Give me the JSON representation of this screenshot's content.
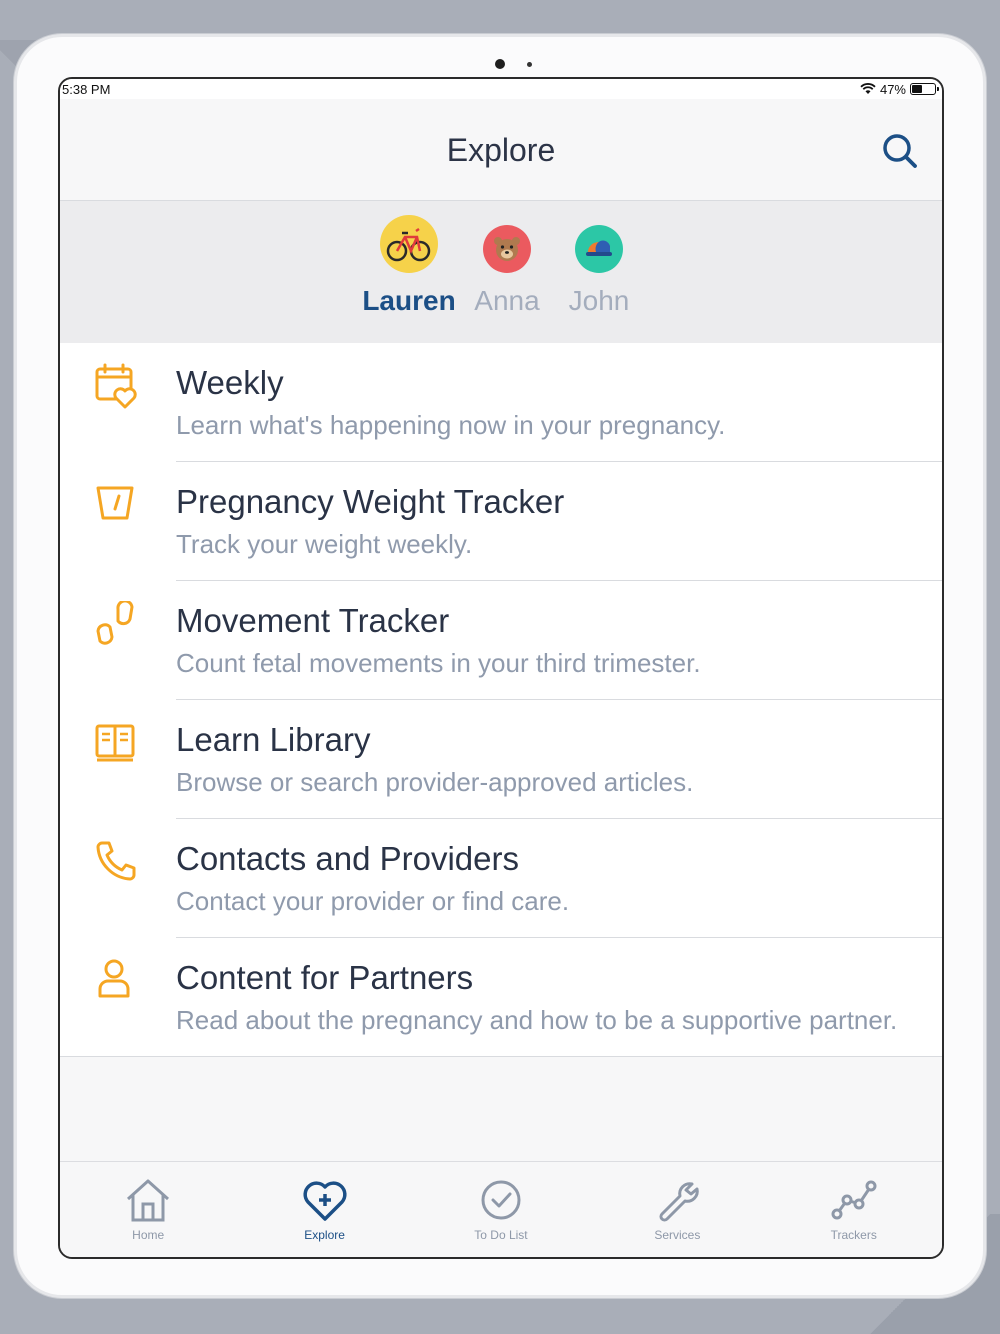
{
  "status": {
    "time": "5:38 PM",
    "battery": "47%",
    "battery_level": 0.47
  },
  "header": {
    "title": "Explore",
    "search_icon": "search-icon"
  },
  "profiles": [
    {
      "name": "Lauren",
      "active": true,
      "icon": "bicycle-icon",
      "color": "#f6d24a"
    },
    {
      "name": "Anna",
      "active": false,
      "icon": "bear-icon",
      "color": "#eb5a5f"
    },
    {
      "name": "John",
      "active": false,
      "icon": "cap-icon",
      "color": "#2cc7a6"
    }
  ],
  "items": [
    {
      "title": "Weekly",
      "desc": "Learn what's happening now in your pregnancy.",
      "icon": "calendar-heart-icon"
    },
    {
      "title": "Pregnancy Weight Tracker",
      "desc": "Track your weight weekly.",
      "icon": "scale-icon"
    },
    {
      "title": "Movement Tracker",
      "desc": "Count fetal movements in your third trimester.",
      "icon": "footprints-icon"
    },
    {
      "title": "Learn Library",
      "desc": "Browse or search provider-approved articles.",
      "icon": "book-icon"
    },
    {
      "title": "Contacts and Providers",
      "desc": "Contact your provider or find care.",
      "icon": "phone-icon"
    },
    {
      "title": "Content for Partners",
      "desc": "Read about the pregnancy and how to be a supportive partner.",
      "icon": "person-icon"
    }
  ],
  "tabs": [
    {
      "label": "Home",
      "icon": "home-icon",
      "active": false
    },
    {
      "label": "Explore",
      "icon": "heart-plus-icon",
      "active": true
    },
    {
      "label": "To Do List",
      "icon": "check-circle-icon",
      "active": false
    },
    {
      "label": "Services",
      "icon": "wrench-icon",
      "active": false
    },
    {
      "label": "Trackers",
      "icon": "trend-icon",
      "active": false
    }
  ],
  "colors": {
    "accent": "#1c4f86",
    "icon_orange": "#f5a623",
    "text_dark": "#2a3346",
    "text_muted": "#8f9aac"
  }
}
